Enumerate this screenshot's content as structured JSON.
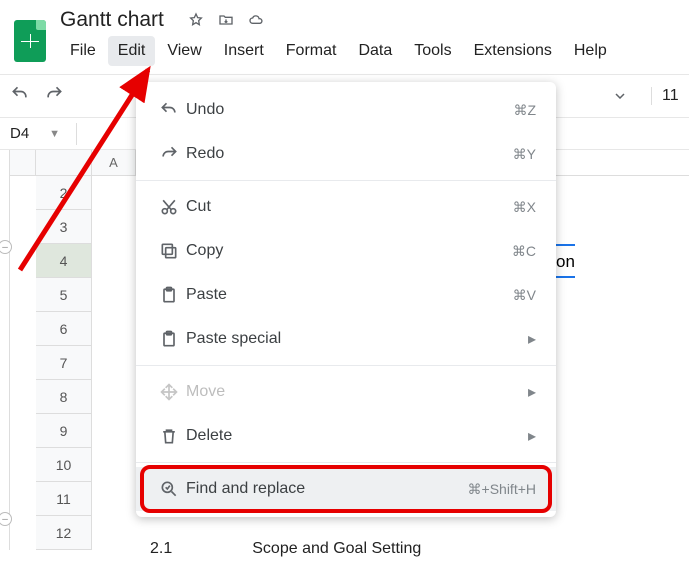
{
  "header": {
    "doc_title": "Gantt chart",
    "menu_items": [
      "File",
      "Edit",
      "View",
      "Insert",
      "Format",
      "Data",
      "Tools",
      "Extensions",
      "Help"
    ],
    "active_menu_index": 1
  },
  "toolbar": {
    "font_size": "11"
  },
  "namebox": {
    "ref": "D4"
  },
  "columns": [
    "A"
  ],
  "rows": [
    "2",
    "3",
    "4",
    "5",
    "6",
    "7",
    "8",
    "9",
    "10",
    "11",
    "12"
  ],
  "active_row": "4",
  "outline_collapse_rows": [
    "4",
    "12"
  ],
  "visible_partial_text": "on",
  "bottom": {
    "wbs": "2.1",
    "desc": "Scope and Goal Setting"
  },
  "edit_menu": [
    {
      "icon": "undo-icon",
      "label": "Undo",
      "shortcut": "⌘Z",
      "disabled": false
    },
    {
      "icon": "redo-icon",
      "label": "Redo",
      "shortcut": "⌘Y",
      "disabled": false
    },
    {
      "sep": true
    },
    {
      "icon": "cut-icon",
      "label": "Cut",
      "shortcut": "⌘X",
      "disabled": false
    },
    {
      "icon": "copy-icon",
      "label": "Copy",
      "shortcut": "⌘C",
      "disabled": false
    },
    {
      "icon": "paste-icon",
      "label": "Paste",
      "shortcut": "⌘V",
      "disabled": false
    },
    {
      "icon": "paste-icon",
      "label": "Paste special",
      "submenu": true,
      "disabled": false
    },
    {
      "sep": true
    },
    {
      "icon": "move-icon",
      "label": "Move",
      "submenu": true,
      "disabled": true
    },
    {
      "icon": "delete-icon",
      "label": "Delete",
      "submenu": true,
      "disabled": false
    },
    {
      "sep": true
    },
    {
      "icon": "find-icon",
      "label": "Find and replace",
      "shortcut": "⌘+Shift+H",
      "highlight": true
    }
  ]
}
